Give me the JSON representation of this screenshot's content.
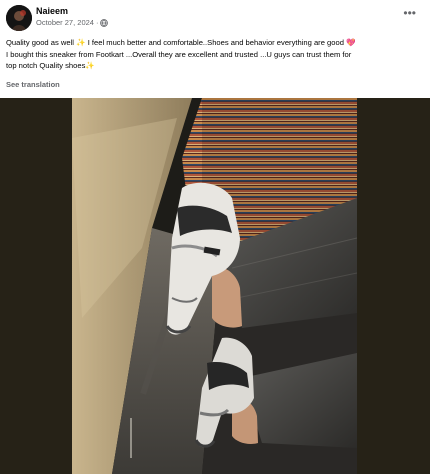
{
  "post": {
    "author": "Naieem",
    "date": "October 27, 2024",
    "separator": "·",
    "text_line1_a": "Quality good as well",
    "text_line1_b": "I feel much better and comfortable..Shoes and behavior  everything are good",
    "text_line2": "I bought this sneaker from  Footkart ...Overall they are excellent and trusted ...U guys can trust them for",
    "text_line3": "top notch Quality shoes",
    "see_translation": "See translation"
  },
  "icons": {
    "avatar": "profile-avatar",
    "privacy": "globe-icon",
    "more": "more-options-icon",
    "sparkle": "sparkles-emoji",
    "heart": "heart-emoji"
  },
  "glyphs": {
    "more": "•••",
    "sparkle": "✨",
    "heart": "💖"
  },
  "colors": {
    "secondary_text": "#65676b",
    "photo_background": "#262217"
  }
}
